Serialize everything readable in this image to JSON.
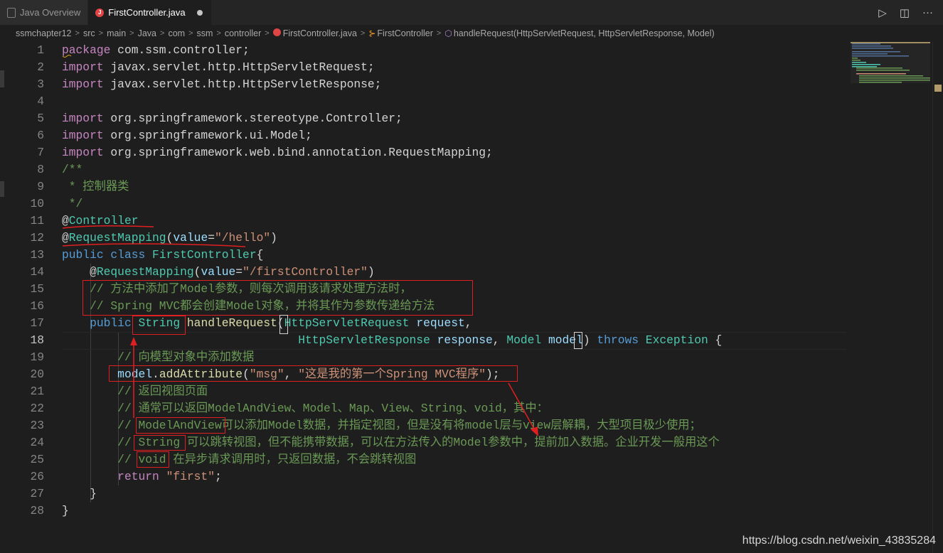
{
  "tabs": [
    {
      "label": "Java Overview",
      "active": false
    },
    {
      "label": "FirstController.java",
      "active": true,
      "dirty": true
    }
  ],
  "breadcrumbs": [
    "ssmchapter12",
    "src",
    "main",
    "Java",
    "com",
    "ssm",
    "controller",
    "FirstController.java",
    "FirstController",
    "handleRequest(HttpServletRequest, HttpServletResponse, Model)"
  ],
  "editor": {
    "current_line": 18,
    "lines": [
      [
        {
          "t": "package",
          "c": "kw2"
        },
        {
          "t": " com.ssm.controller;",
          "c": "pl"
        }
      ],
      [
        {
          "t": "import",
          "c": "kw2"
        },
        {
          "t": " javax.servlet.http.HttpServletRequest;",
          "c": "pl"
        }
      ],
      [
        {
          "t": "import",
          "c": "kw2"
        },
        {
          "t": " javax.servlet.http.HttpServletResponse;",
          "c": "pl"
        }
      ],
      [],
      [
        {
          "t": "import",
          "c": "kw2"
        },
        {
          "t": " org.springframework.stereotype.Controller;",
          "c": "pl"
        }
      ],
      [
        {
          "t": "import",
          "c": "kw2"
        },
        {
          "t": " org.springframework.ui.Model;",
          "c": "pl"
        }
      ],
      [
        {
          "t": "import",
          "c": "kw2"
        },
        {
          "t": " org.springframework.web.bind.annotation.RequestMapping;",
          "c": "pl"
        }
      ],
      [
        {
          "t": "/**",
          "c": "cm"
        }
      ],
      [
        {
          "t": " * 控制器类",
          "c": "cm"
        }
      ],
      [
        {
          "t": " */",
          "c": "cm"
        }
      ],
      [
        {
          "t": "@",
          "c": "pl"
        },
        {
          "t": "Controller",
          "c": "ty"
        }
      ],
      [
        {
          "t": "@",
          "c": "pl"
        },
        {
          "t": "RequestMapping",
          "c": "ty"
        },
        {
          "t": "(",
          "c": "pl"
        },
        {
          "t": "value",
          "c": "va"
        },
        {
          "t": "=",
          "c": "pl"
        },
        {
          "t": "\"/hello\"",
          "c": "st"
        },
        {
          "t": ")",
          "c": "pl"
        }
      ],
      [
        {
          "t": "public",
          "c": "kw"
        },
        {
          "t": " ",
          "c": "pl"
        },
        {
          "t": "class",
          "c": "kw"
        },
        {
          "t": " ",
          "c": "pl"
        },
        {
          "t": "FirstController",
          "c": "ty"
        },
        {
          "t": "{",
          "c": "pl"
        }
      ],
      [
        {
          "t": "    @",
          "c": "pl"
        },
        {
          "t": "RequestMapping",
          "c": "ty"
        },
        {
          "t": "(",
          "c": "pl"
        },
        {
          "t": "value",
          "c": "va"
        },
        {
          "t": "=",
          "c": "pl"
        },
        {
          "t": "\"/firstController\"",
          "c": "st"
        },
        {
          "t": ")",
          "c": "pl"
        }
      ],
      [
        {
          "t": "    ",
          "c": "pl"
        },
        {
          "t": "// 方法中添加了Model参数，则每次调用该请求处理方法时，",
          "c": "cm"
        }
      ],
      [
        {
          "t": "    ",
          "c": "pl"
        },
        {
          "t": "// Spring MVC都会创建Model对象，并将其作为参数传递给方法",
          "c": "cm"
        }
      ],
      [
        {
          "t": "    ",
          "c": "pl"
        },
        {
          "t": "public",
          "c": "kw"
        },
        {
          "t": " ",
          "c": "pl"
        },
        {
          "t": "String",
          "c": "ty"
        },
        {
          "t": " ",
          "c": "pl"
        },
        {
          "t": "handleRequest",
          "c": "fn"
        },
        {
          "t": "(",
          "c": "pl"
        },
        {
          "t": "HttpServletRequest",
          "c": "ty"
        },
        {
          "t": " ",
          "c": "pl"
        },
        {
          "t": "request",
          "c": "va"
        },
        {
          "t": ",",
          "c": "pl"
        }
      ],
      [
        {
          "t": "                                  ",
          "c": "pl"
        },
        {
          "t": "HttpServletResponse",
          "c": "ty"
        },
        {
          "t": " ",
          "c": "pl"
        },
        {
          "t": "response",
          "c": "va"
        },
        {
          "t": ", ",
          "c": "pl"
        },
        {
          "t": "Model",
          "c": "ty"
        },
        {
          "t": " ",
          "c": "pl"
        },
        {
          "t": "model",
          "c": "va"
        },
        {
          "t": ") ",
          "c": "pl"
        },
        {
          "t": "throws",
          "c": "kw"
        },
        {
          "t": " ",
          "c": "pl"
        },
        {
          "t": "Exception",
          "c": "ty"
        },
        {
          "t": " {",
          "c": "pl"
        }
      ],
      [
        {
          "t": "        ",
          "c": "pl"
        },
        {
          "t": "// 向模型对象中添加数据",
          "c": "cm"
        }
      ],
      [
        {
          "t": "        ",
          "c": "pl"
        },
        {
          "t": "model",
          "c": "va"
        },
        {
          "t": ".",
          "c": "pl"
        },
        {
          "t": "addAttribute",
          "c": "fn"
        },
        {
          "t": "(",
          "c": "pl"
        },
        {
          "t": "\"msg\"",
          "c": "st"
        },
        {
          "t": ", ",
          "c": "pl"
        },
        {
          "t": "\"这是我的第一个Spring MVC程序\"",
          "c": "st"
        },
        {
          "t": ");",
          "c": "pl"
        }
      ],
      [
        {
          "t": "        ",
          "c": "pl"
        },
        {
          "t": "// 返回视图页面",
          "c": "cm"
        }
      ],
      [
        {
          "t": "        ",
          "c": "pl"
        },
        {
          "t": "// 通常可以返回ModelAndView、Model、Map、View、String、void，其中：",
          "c": "cm"
        }
      ],
      [
        {
          "t": "        ",
          "c": "pl"
        },
        {
          "t": "// ModelAndView可以添加Model数据，并指定视图，但是没有将model层与view层解耦，大型项目极少使用；",
          "c": "cm"
        }
      ],
      [
        {
          "t": "        ",
          "c": "pl"
        },
        {
          "t": "// String 可以跳转视图，但不能携带数据，可以在方法传入的Model参数中，提前加入数据。企业开发一般用这个",
          "c": "cm"
        }
      ],
      [
        {
          "t": "        ",
          "c": "pl"
        },
        {
          "t": "// void 在异步请求调用时，只返回数据，不会跳转视图",
          "c": "cm"
        }
      ],
      [
        {
          "t": "        ",
          "c": "pl"
        },
        {
          "t": "return",
          "c": "kw2"
        },
        {
          "t": " ",
          "c": "pl"
        },
        {
          "t": "\"first\"",
          "c": "st"
        },
        {
          "t": ";",
          "c": "pl"
        }
      ],
      [
        {
          "t": "    }",
          "c": "pl"
        }
      ],
      [
        {
          "t": "}",
          "c": "pl"
        }
      ]
    ]
  },
  "watermark": "https://blog.csdn.net/weixin_43835284",
  "colors": {
    "annotation": "#e02020",
    "background": "#1e1e1e"
  }
}
